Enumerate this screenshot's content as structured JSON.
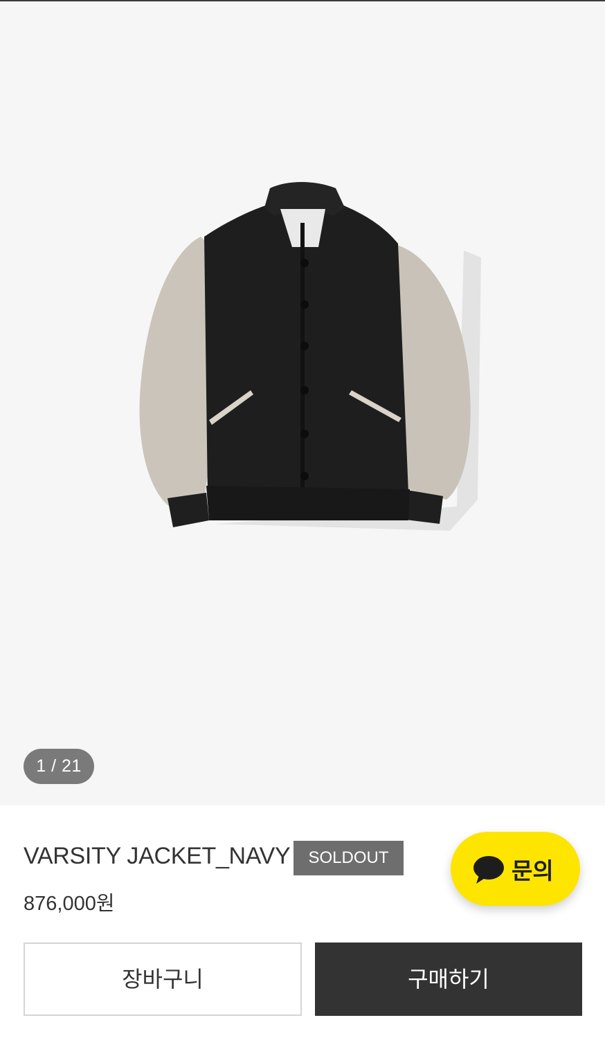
{
  "gallery": {
    "counter": "1 / 21"
  },
  "product": {
    "name": "VARSITY JACKET_NAVY",
    "status_badge": "SOLDOUT",
    "price": "876,000원"
  },
  "inquiry": {
    "label": "문의",
    "icon": "chat-bubble-icon",
    "color": "#fde500"
  },
  "actions": {
    "cart_label": "장바구니",
    "buy_label": "구매하기"
  },
  "colors": {
    "gallery_bg": "#f6f6f6",
    "badge_bg": "#6e6e6e",
    "buy_bg": "#333333",
    "kakao_yellow": "#fde500"
  }
}
